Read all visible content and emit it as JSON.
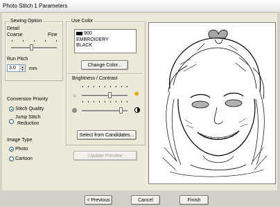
{
  "window": {
    "title": "Photo Stitch 1 Parameters"
  },
  "sewing_option": {
    "legend": "Sewing Option",
    "detail_label": "Detail",
    "coarse_label": "Coarse",
    "fine_label": "Fine",
    "detail_level": 0.45,
    "run_pitch_label": "Run Pitch",
    "run_pitch_value": "3.0",
    "run_pitch_unit": "mm"
  },
  "conversion_priority": {
    "label": "Conversion Priority",
    "options": [
      {
        "label": "Stitch Quality",
        "selected": true
      },
      {
        "label_line1": "Jump Stitch",
        "label_line2": "Reduction",
        "selected": false
      }
    ]
  },
  "image_type": {
    "label": "Image Type",
    "options": [
      {
        "label": "Photo",
        "selected": true
      },
      {
        "label": "Cartoon",
        "selected": false
      }
    ]
  },
  "use_color": {
    "legend": "Use Color",
    "swatch_color": "#000000",
    "color_number": "900",
    "color_line2": "EMBROIDERY",
    "color_line3": "BLACK",
    "change_color_button": "Change Color..."
  },
  "brightness_contrast": {
    "label": "Brightness / Contrast",
    "brightness_level": 0.62,
    "contrast_level": 0.86,
    "brightness_icon": "sun-icon",
    "contrast_icon": "contrast-icon"
  },
  "select_candidates_button": "Select from Candidates...",
  "update_preview_button": "Update Preview",
  "footer": {
    "previous_button": "< Previous",
    "cancel_button": "Cancel",
    "finish_button": "Finish"
  },
  "preview": {
    "description_icon": "photo-stitch-preview-icon"
  }
}
